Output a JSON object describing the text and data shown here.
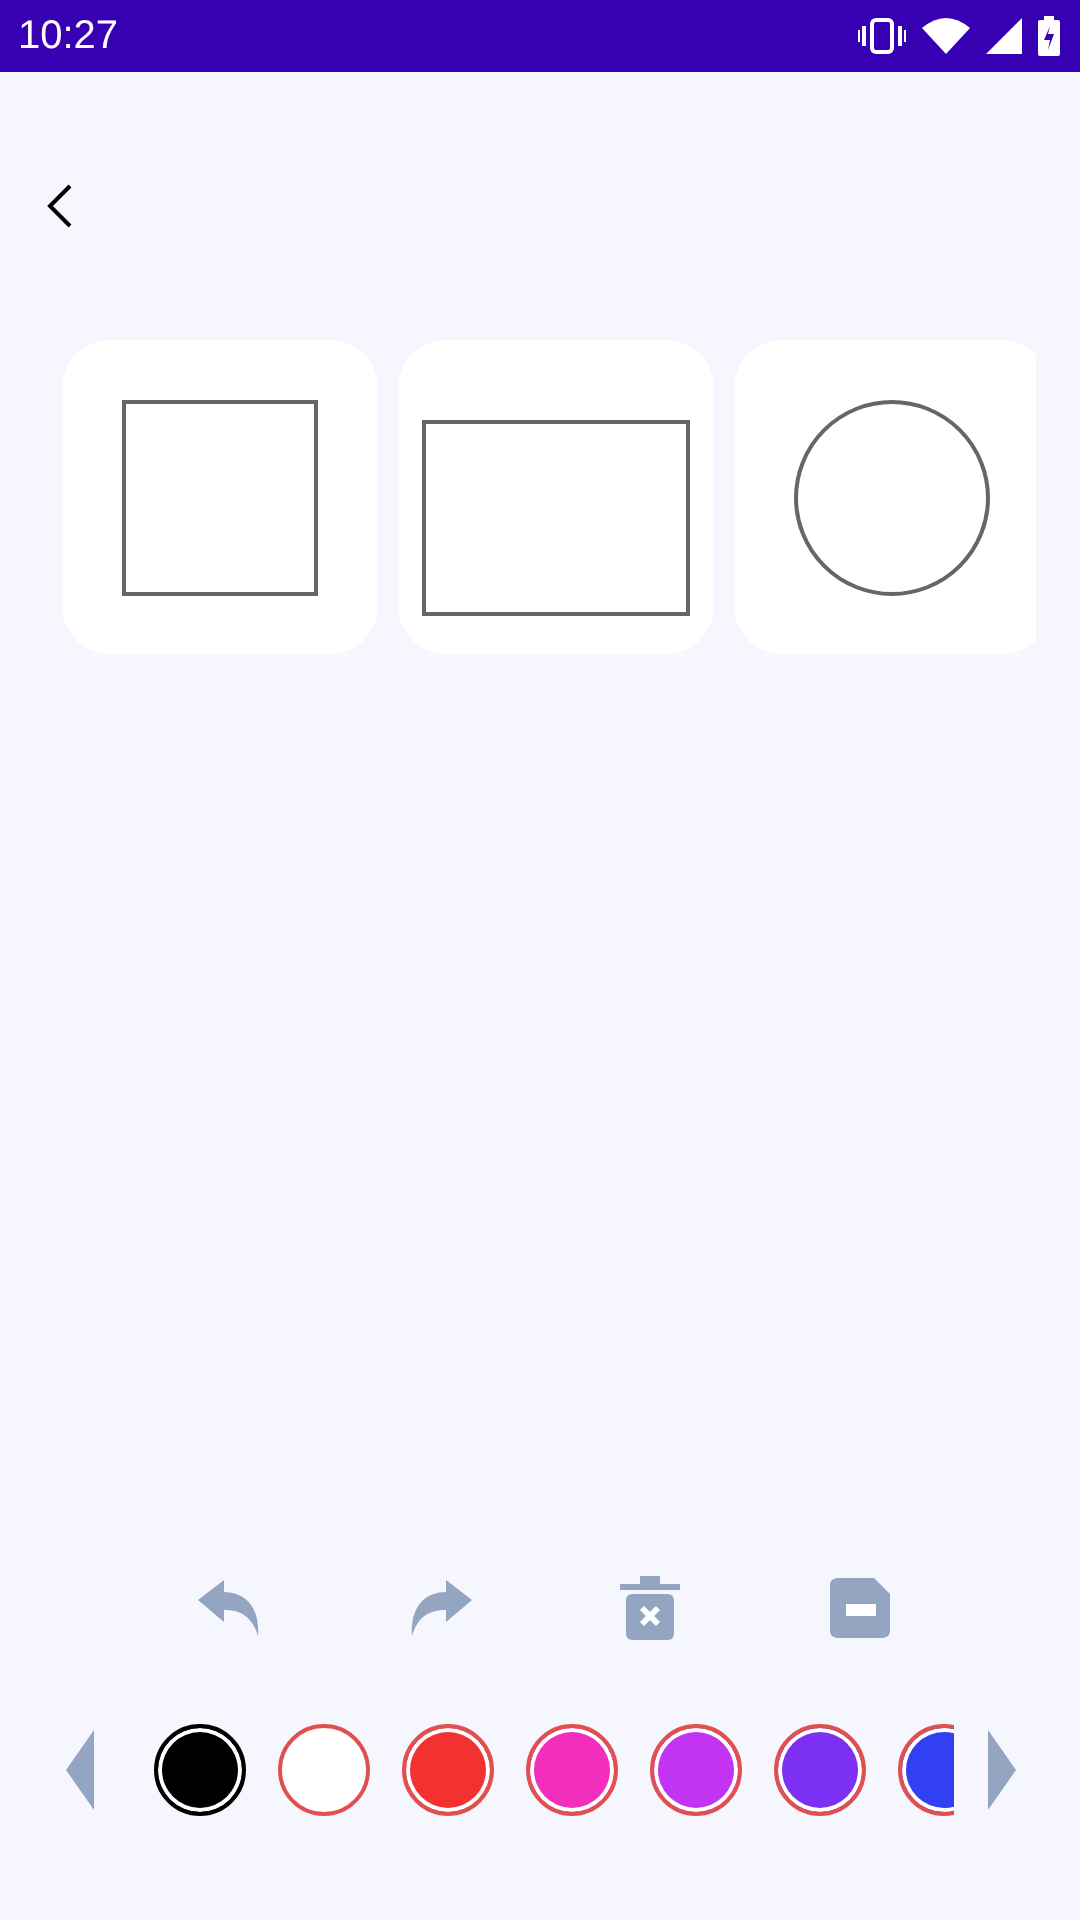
{
  "status_bar": {
    "time": "10:27"
  },
  "shapes": [
    {
      "kind": "square"
    },
    {
      "kind": "rectangle"
    },
    {
      "kind": "circle"
    }
  ],
  "palette": [
    {
      "color": "#000000",
      "selected": true
    },
    {
      "color": "#ffffff",
      "selected": false
    },
    {
      "color": "#f33131",
      "selected": false
    },
    {
      "color": "#f22fbd",
      "selected": false
    },
    {
      "color": "#c233f2",
      "selected": false
    },
    {
      "color": "#7c31f2",
      "selected": false
    },
    {
      "color": "#3040f2",
      "selected": false
    }
  ]
}
